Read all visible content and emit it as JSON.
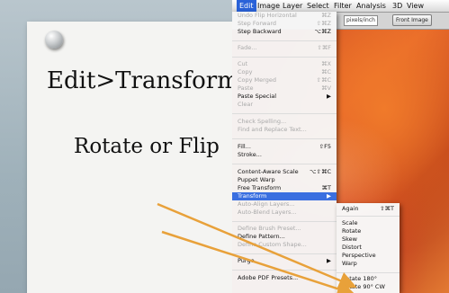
{
  "slide": {
    "title": "Edit>Transform",
    "subtitle": "Rotate or Flip"
  },
  "menubar": {
    "items": [
      "Edit",
      "Image",
      "Layer",
      "Select",
      "Filter",
      "Analysis",
      "3D",
      "View"
    ]
  },
  "options_bar": {
    "resolution_field": "pixels/inch",
    "value_field": "1",
    "front_image_button": "Front Image"
  },
  "edit_menu": {
    "items": [
      {
        "label": "Undo Flip Horizontal",
        "shortcut": "⌘Z"
      },
      {
        "label": "Step Forward",
        "shortcut": "⇧⌘Z"
      },
      {
        "label": "Step Backward",
        "shortcut": "⌥⌘Z"
      },
      {
        "label": "Fade...",
        "shortcut": "⇧⌘F"
      },
      {
        "label": "Cut",
        "shortcut": "⌘X"
      },
      {
        "label": "Copy",
        "shortcut": "⌘C"
      },
      {
        "label": "Copy Merged",
        "shortcut": "⇧⌘C"
      },
      {
        "label": "Paste",
        "shortcut": "⌘V"
      },
      {
        "label": "Paste Special",
        "shortcut": "▶"
      },
      {
        "label": "Clear",
        "shortcut": ""
      },
      {
        "label": "Check Spelling...",
        "shortcut": ""
      },
      {
        "label": "Find and Replace Text...",
        "shortcut": ""
      },
      {
        "label": "Fill...",
        "shortcut": "⇧F5"
      },
      {
        "label": "Stroke...",
        "shortcut": ""
      },
      {
        "label": "Content-Aware Scale",
        "shortcut": "⌥⇧⌘C"
      },
      {
        "label": "Puppet Warp",
        "shortcut": ""
      },
      {
        "label": "Free Transform",
        "shortcut": "⌘T"
      },
      {
        "label": "Transform",
        "shortcut": "▶"
      },
      {
        "label": "Auto-Align Layers...",
        "shortcut": ""
      },
      {
        "label": "Auto-Blend Layers...",
        "shortcut": ""
      },
      {
        "label": "Define Brush Preset...",
        "shortcut": ""
      },
      {
        "label": "Define Pattern...",
        "shortcut": ""
      },
      {
        "label": "Define Custom Shape...",
        "shortcut": ""
      },
      {
        "label": "Purge",
        "shortcut": "▶"
      },
      {
        "label": "Adobe PDF Presets...",
        "shortcut": ""
      }
    ]
  },
  "transform_submenu": {
    "items": [
      {
        "label": "Again",
        "shortcut": "⇧⌘T"
      },
      {
        "label": "Scale",
        "shortcut": ""
      },
      {
        "label": "Rotate",
        "shortcut": ""
      },
      {
        "label": "Skew",
        "shortcut": ""
      },
      {
        "label": "Distort",
        "shortcut": ""
      },
      {
        "label": "Perspective",
        "shortcut": ""
      },
      {
        "label": "Warp",
        "shortcut": ""
      },
      {
        "label": "Rotate 180°",
        "shortcut": ""
      },
      {
        "label": "Rotate 90° CW",
        "shortcut": ""
      }
    ]
  },
  "colors": {
    "menu_highlight": "#3a6fe0",
    "arrow": "#e8a13a",
    "canvas_orange": "#e8682a"
  }
}
